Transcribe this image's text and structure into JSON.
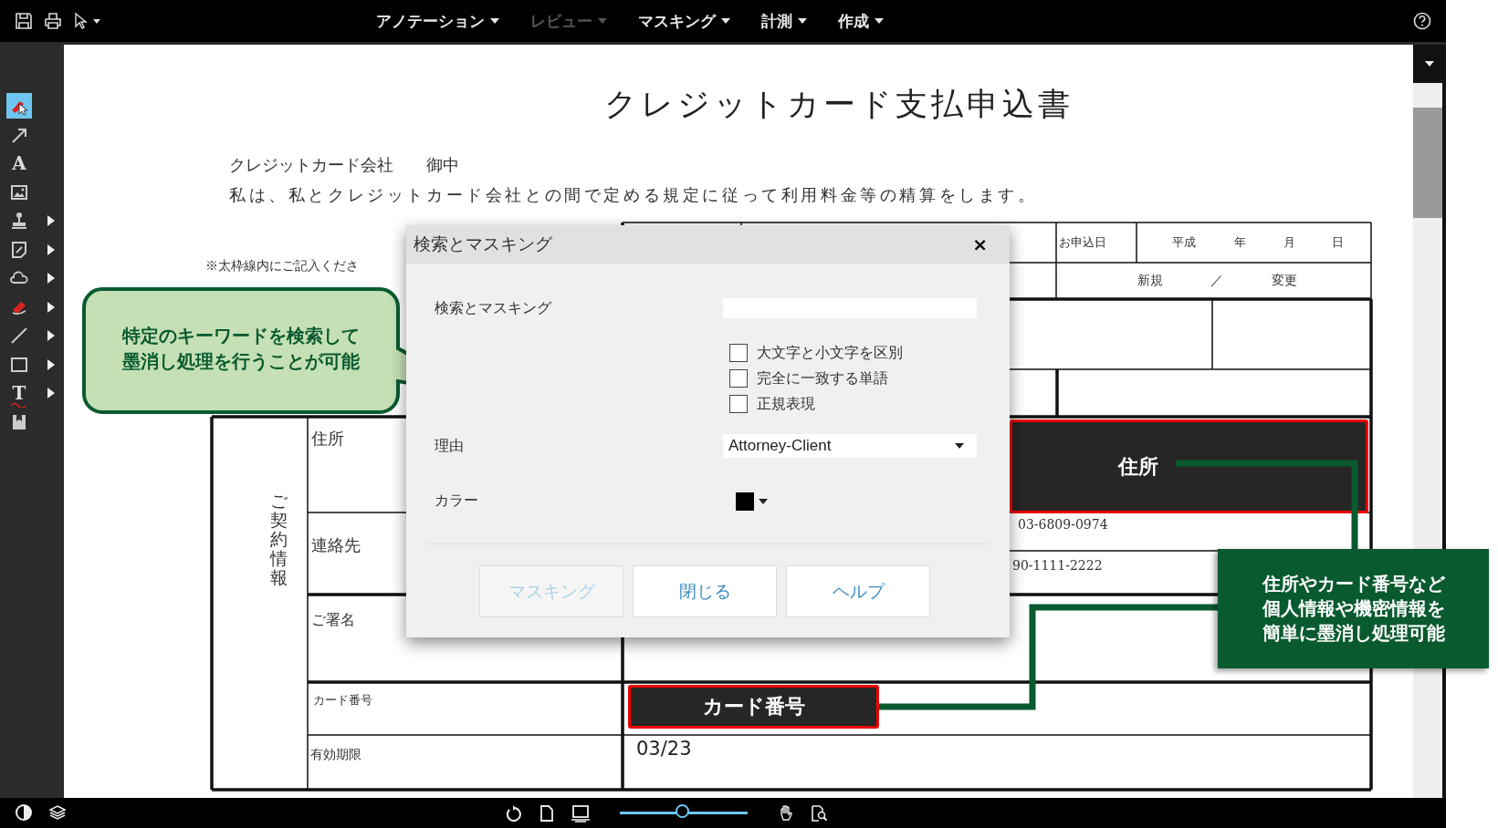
{
  "toolbar": {
    "menus": [
      {
        "label": "アノテーション",
        "disabled": false
      },
      {
        "label": "レビュー",
        "disabled": true
      },
      {
        "label": "マスキング",
        "disabled": false
      },
      {
        "label": "計測",
        "disabled": false
      },
      {
        "label": "作成",
        "disabled": false
      }
    ]
  },
  "tools": [
    {
      "kind": "redact-pointer",
      "selected": true,
      "submenu": false
    },
    {
      "kind": "arrow",
      "selected": false,
      "submenu": false
    },
    {
      "kind": "text",
      "glyph": "A",
      "selected": false,
      "submenu": false
    },
    {
      "kind": "image",
      "selected": false,
      "submenu": false
    },
    {
      "kind": "stamp",
      "selected": false,
      "submenu": true
    },
    {
      "kind": "attach",
      "selected": false,
      "submenu": true
    },
    {
      "kind": "cloud",
      "selected": false,
      "submenu": true
    },
    {
      "kind": "eraser",
      "selected": false,
      "submenu": true
    },
    {
      "kind": "line",
      "selected": false,
      "submenu": true
    },
    {
      "kind": "rect",
      "selected": false,
      "submenu": true
    },
    {
      "kind": "strike",
      "glyph": "T",
      "selected": false,
      "submenu": true
    },
    {
      "kind": "bookmark",
      "selected": false,
      "submenu": false
    }
  ],
  "document": {
    "title": "クレジットカード支払申込書",
    "addressee": "クレジットカード会社　　御中",
    "statement": "私は、私とクレジットカード会社との間で定める規定に従って利用料金等の精算をします。",
    "note": "※太枠線内にご記入くださ",
    "form": {
      "date_label": "お申込日",
      "era": "平成",
      "year": "年",
      "month": "月",
      "day": "日",
      "new": "新規",
      "slash": "／",
      "change": "変更",
      "section": "ご契約情報",
      "address_label": "住所",
      "contact_label": "連絡先",
      "phone_1": "03-6809-0974",
      "phone_2": "90-1111-2222",
      "signature_label": "ご署名",
      "card_label": "カード番号",
      "expiry_label": "有効期限",
      "expiry": "03/23"
    },
    "redactions": [
      {
        "kind": "address",
        "label": "住所"
      },
      {
        "kind": "card",
        "label": "カード番号"
      }
    ]
  },
  "dialog": {
    "title": "検索とマスキング",
    "close": "×",
    "search_label": "検索とマスキング",
    "options": [
      {
        "label": "大文字と小文字を区別",
        "checked": false
      },
      {
        "label": "完全に一致する単語",
        "checked": false
      },
      {
        "label": "正規表現",
        "checked": false
      }
    ],
    "reason_label": "理由",
    "reason": "Attorney-Client",
    "color_label": "カラー",
    "color": "#000000",
    "buttons": [
      {
        "label": "マスキング",
        "disabled": true
      },
      {
        "label": "閉じる",
        "disabled": false
      },
      {
        "label": "ヘルプ",
        "disabled": false
      }
    ]
  },
  "callouts": [
    {
      "kind": "bubble",
      "lines": [
        "特定のキーワードを検索して",
        "墨消し処理を行うことが可能"
      ]
    },
    {
      "kind": "box",
      "lines": [
        "住所やカード番号など",
        "個人情報や機密情報を",
        "簡単に墨消し処理可能"
      ]
    }
  ],
  "zoom": {
    "level": 0.5
  }
}
